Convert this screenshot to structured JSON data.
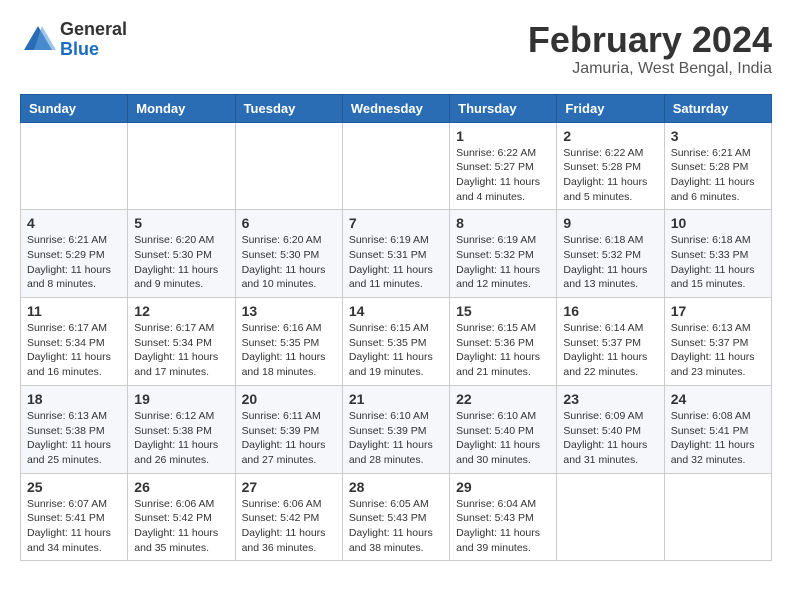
{
  "header": {
    "logo": {
      "line1": "General",
      "line2": "Blue"
    },
    "title": "February 2024",
    "subtitle": "Jamuria, West Bengal, India"
  },
  "calendar": {
    "days_of_week": [
      "Sunday",
      "Monday",
      "Tuesday",
      "Wednesday",
      "Thursday",
      "Friday",
      "Saturday"
    ],
    "weeks": [
      [
        {
          "day": "",
          "info": ""
        },
        {
          "day": "",
          "info": ""
        },
        {
          "day": "",
          "info": ""
        },
        {
          "day": "",
          "info": ""
        },
        {
          "day": "1",
          "info": "Sunrise: 6:22 AM\nSunset: 5:27 PM\nDaylight: 11 hours\nand 4 minutes."
        },
        {
          "day": "2",
          "info": "Sunrise: 6:22 AM\nSunset: 5:28 PM\nDaylight: 11 hours\nand 5 minutes."
        },
        {
          "day": "3",
          "info": "Sunrise: 6:21 AM\nSunset: 5:28 PM\nDaylight: 11 hours\nand 6 minutes."
        }
      ],
      [
        {
          "day": "4",
          "info": "Sunrise: 6:21 AM\nSunset: 5:29 PM\nDaylight: 11 hours\nand 8 minutes."
        },
        {
          "day": "5",
          "info": "Sunrise: 6:20 AM\nSunset: 5:30 PM\nDaylight: 11 hours\nand 9 minutes."
        },
        {
          "day": "6",
          "info": "Sunrise: 6:20 AM\nSunset: 5:30 PM\nDaylight: 11 hours\nand 10 minutes."
        },
        {
          "day": "7",
          "info": "Sunrise: 6:19 AM\nSunset: 5:31 PM\nDaylight: 11 hours\nand 11 minutes."
        },
        {
          "day": "8",
          "info": "Sunrise: 6:19 AM\nSunset: 5:32 PM\nDaylight: 11 hours\nand 12 minutes."
        },
        {
          "day": "9",
          "info": "Sunrise: 6:18 AM\nSunset: 5:32 PM\nDaylight: 11 hours\nand 13 minutes."
        },
        {
          "day": "10",
          "info": "Sunrise: 6:18 AM\nSunset: 5:33 PM\nDaylight: 11 hours\nand 15 minutes."
        }
      ],
      [
        {
          "day": "11",
          "info": "Sunrise: 6:17 AM\nSunset: 5:34 PM\nDaylight: 11 hours\nand 16 minutes."
        },
        {
          "day": "12",
          "info": "Sunrise: 6:17 AM\nSunset: 5:34 PM\nDaylight: 11 hours\nand 17 minutes."
        },
        {
          "day": "13",
          "info": "Sunrise: 6:16 AM\nSunset: 5:35 PM\nDaylight: 11 hours\nand 18 minutes."
        },
        {
          "day": "14",
          "info": "Sunrise: 6:15 AM\nSunset: 5:35 PM\nDaylight: 11 hours\nand 19 minutes."
        },
        {
          "day": "15",
          "info": "Sunrise: 6:15 AM\nSunset: 5:36 PM\nDaylight: 11 hours\nand 21 minutes."
        },
        {
          "day": "16",
          "info": "Sunrise: 6:14 AM\nSunset: 5:37 PM\nDaylight: 11 hours\nand 22 minutes."
        },
        {
          "day": "17",
          "info": "Sunrise: 6:13 AM\nSunset: 5:37 PM\nDaylight: 11 hours\nand 23 minutes."
        }
      ],
      [
        {
          "day": "18",
          "info": "Sunrise: 6:13 AM\nSunset: 5:38 PM\nDaylight: 11 hours\nand 25 minutes."
        },
        {
          "day": "19",
          "info": "Sunrise: 6:12 AM\nSunset: 5:38 PM\nDaylight: 11 hours\nand 26 minutes."
        },
        {
          "day": "20",
          "info": "Sunrise: 6:11 AM\nSunset: 5:39 PM\nDaylight: 11 hours\nand 27 minutes."
        },
        {
          "day": "21",
          "info": "Sunrise: 6:10 AM\nSunset: 5:39 PM\nDaylight: 11 hours\nand 28 minutes."
        },
        {
          "day": "22",
          "info": "Sunrise: 6:10 AM\nSunset: 5:40 PM\nDaylight: 11 hours\nand 30 minutes."
        },
        {
          "day": "23",
          "info": "Sunrise: 6:09 AM\nSunset: 5:40 PM\nDaylight: 11 hours\nand 31 minutes."
        },
        {
          "day": "24",
          "info": "Sunrise: 6:08 AM\nSunset: 5:41 PM\nDaylight: 11 hours\nand 32 minutes."
        }
      ],
      [
        {
          "day": "25",
          "info": "Sunrise: 6:07 AM\nSunset: 5:41 PM\nDaylight: 11 hours\nand 34 minutes."
        },
        {
          "day": "26",
          "info": "Sunrise: 6:06 AM\nSunset: 5:42 PM\nDaylight: 11 hours\nand 35 minutes."
        },
        {
          "day": "27",
          "info": "Sunrise: 6:06 AM\nSunset: 5:42 PM\nDaylight: 11 hours\nand 36 minutes."
        },
        {
          "day": "28",
          "info": "Sunrise: 6:05 AM\nSunset: 5:43 PM\nDaylight: 11 hours\nand 38 minutes."
        },
        {
          "day": "29",
          "info": "Sunrise: 6:04 AM\nSunset: 5:43 PM\nDaylight: 11 hours\nand 39 minutes."
        },
        {
          "day": "",
          "info": ""
        },
        {
          "day": "",
          "info": ""
        }
      ]
    ]
  }
}
